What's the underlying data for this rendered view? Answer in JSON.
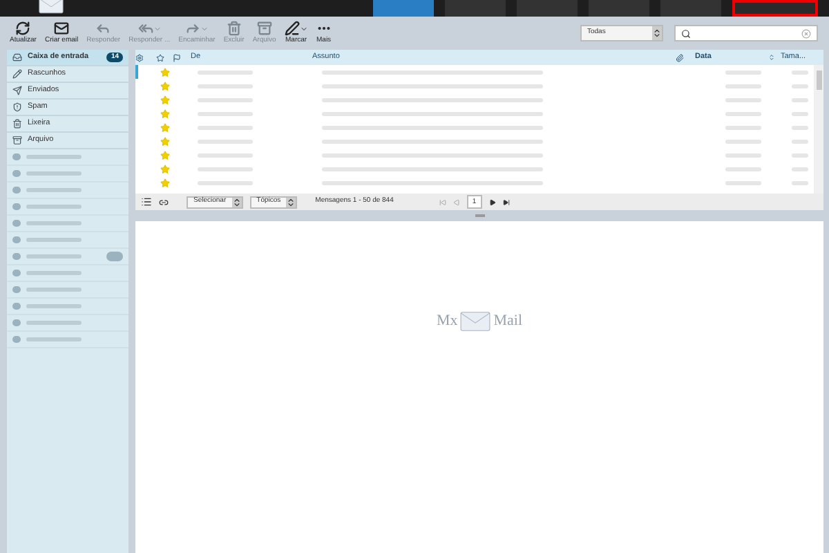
{
  "toolbar": {
    "buttons": [
      {
        "label": "Atualizar",
        "kind": "refresh",
        "disabled": false,
        "has_menu": false
      },
      {
        "label": "Criar email",
        "kind": "compose",
        "disabled": false,
        "has_menu": false
      },
      {
        "label": "Responder",
        "kind": "reply",
        "disabled": true,
        "has_menu": false
      },
      {
        "label": "Responder ...",
        "kind": "reply-all",
        "disabled": true,
        "has_menu": true
      },
      {
        "label": "Encaminhar",
        "kind": "forward",
        "disabled": true,
        "has_menu": true
      },
      {
        "label": "Excluir",
        "kind": "delete",
        "disabled": true,
        "has_menu": false
      },
      {
        "label": "Arquivo",
        "kind": "archive",
        "disabled": true,
        "has_menu": false
      },
      {
        "label": "Marcar",
        "kind": "mark",
        "disabled": false,
        "has_menu": true
      },
      {
        "label": "Mais",
        "kind": "more",
        "disabled": false,
        "has_menu": false
      }
    ]
  },
  "nav_tabs": [
    {
      "selected": true
    },
    {
      "selected": false
    },
    {
      "selected": false
    },
    {
      "selected": false
    },
    {
      "selected": false
    }
  ],
  "filter": {
    "value": "Todas"
  },
  "folders": [
    {
      "label": "Caixa de entrada",
      "kind": "inbox",
      "selected": true,
      "badge": "14"
    },
    {
      "label": "Rascunhos",
      "kind": "drafts",
      "selected": false
    },
    {
      "label": "Enviados",
      "kind": "sent",
      "selected": false
    },
    {
      "label": "Spam",
      "kind": "spam",
      "selected": false
    },
    {
      "label": "Lixeira",
      "kind": "trash",
      "selected": false
    },
    {
      "label": "Arquivo",
      "kind": "archive",
      "selected": false
    }
  ],
  "blurred_folders": [
    {
      "badge": false
    },
    {
      "badge": false
    },
    {
      "badge": false
    },
    {
      "badge": false
    },
    {
      "badge": false
    },
    {
      "badge": false
    },
    {
      "badge": true
    },
    {
      "badge": false
    },
    {
      "badge": false
    },
    {
      "badge": false
    },
    {
      "badge": false
    },
    {
      "badge": false
    }
  ],
  "message_list": {
    "columns": [
      {
        "label": "De",
        "sorted": false
      },
      {
        "label": "Assunto",
        "sorted": false
      },
      {
        "label": "Data",
        "sorted": true
      },
      {
        "label": "Tama...",
        "sorted": false
      }
    ],
    "rows": [
      {
        "starred": true,
        "selected": true
      },
      {
        "starred": true,
        "selected": false
      },
      {
        "starred": true,
        "selected": false
      },
      {
        "starred": true,
        "selected": false
      },
      {
        "starred": true,
        "selected": false
      },
      {
        "starred": true,
        "selected": false
      },
      {
        "starred": true,
        "selected": false
      },
      {
        "starred": true,
        "selected": false
      },
      {
        "starred": true,
        "selected": false
      }
    ]
  },
  "footer": {
    "select_label": "Selecionar",
    "threads_label": "Tópicos",
    "count": "Mensagens 1 - 50 de 844",
    "page": "1"
  },
  "preview": {
    "logo_left": "Mx",
    "logo_right": "Mail"
  }
}
